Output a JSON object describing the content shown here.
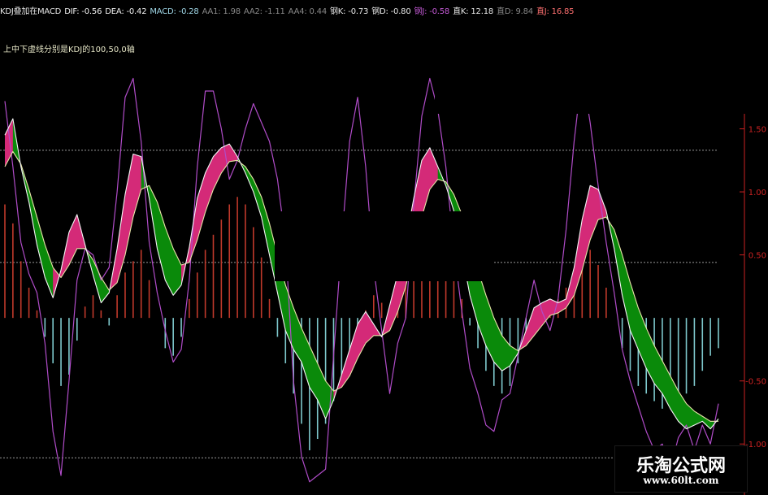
{
  "legend": [
    {
      "text": "KDJ叠加在MACD",
      "color": "#e6e6e6"
    },
    {
      "text": "DIF: -0.56",
      "color": "#f2f2f2"
    },
    {
      "text": "DEA: -0.42",
      "color": "#f2f2f2"
    },
    {
      "text": "MACD: -0.28",
      "color": "#9fd6e6"
    },
    {
      "text": "AA1: 1.98",
      "color": "#888888"
    },
    {
      "text": "AA2: -1.11",
      "color": "#888888"
    },
    {
      "text": "AA4: 0.44",
      "color": "#888888"
    },
    {
      "text": "钢K: -0.73",
      "color": "#e6e6e6"
    },
    {
      "text": "钢D: -0.80",
      "color": "#e6e6e6"
    },
    {
      "text": "钢J: -0.58",
      "color": "#c45ad6"
    },
    {
      "text": "直K: 12.18",
      "color": "#e6e6e6"
    },
    {
      "text": "直D: 9.84",
      "color": "#888888"
    },
    {
      "text": "直J: 16.85",
      "color": "#ff7070"
    }
  ],
  "note": "上中下虚线分别是KDJ的100,50,0轴",
  "watermark": {
    "title": "乐淘公式网",
    "url": "www.60lt.com"
  },
  "colors": {
    "background": "#000000",
    "dif": "#f5f5f5",
    "dea": "#e8e4a8",
    "kdj_j": "#b04cc8",
    "band_up": "#d42a78",
    "band_down": "#0a8a0a",
    "hist_pos": "#c0392b",
    "hist_neg": "#7ec8cc",
    "grid": "#9a9a9a",
    "axis": "#cc2222"
  },
  "chart_data": {
    "type": "line",
    "title": "",
    "xlabel": "",
    "ylabel": "",
    "ylim": [
      -1.25,
      1.6
    ],
    "yticks": [
      "1.50",
      "1.00",
      "0.50",
      "-0.50",
      "-1.00"
    ],
    "yticks_values": [
      1.5,
      1.0,
      0.5,
      -0.5,
      -1.0
    ],
    "reference_lines": [
      {
        "label": "KDJ 100",
        "value": 1.33
      },
      {
        "label": "KDJ 50",
        "value": 0.44
      },
      {
        "label": "KDJ 0",
        "value": -1.11
      }
    ],
    "x": [
      0,
      1,
      2,
      3,
      4,
      5,
      6,
      7,
      8,
      9,
      10,
      11,
      12,
      13,
      14,
      15,
      16,
      17,
      18,
      19,
      20,
      21,
      22,
      23,
      24,
      25,
      26,
      27,
      28,
      29,
      30,
      31,
      32,
      33,
      34,
      35,
      36,
      37,
      38,
      39,
      40,
      41,
      42,
      43,
      44,
      45,
      46,
      47,
      48,
      49,
      50,
      51,
      52,
      53,
      54,
      55,
      56,
      57,
      58,
      59,
      60,
      61,
      62,
      63,
      64,
      65,
      66,
      67,
      68,
      69,
      70,
      71,
      72,
      73,
      74,
      75,
      76,
      77,
      78,
      79,
      80,
      81,
      82,
      83,
      84,
      85,
      86,
      87,
      88,
      89
    ],
    "series": [
      {
        "name": "DIF",
        "values": [
          1.45,
          1.58,
          1.2,
          0.92,
          0.58,
          0.32,
          0.16,
          0.38,
          0.68,
          0.82,
          0.58,
          0.34,
          0.12,
          0.2,
          0.55,
          0.98,
          1.3,
          1.28,
          0.95,
          0.55,
          0.3,
          0.18,
          0.26,
          0.56,
          0.95,
          1.15,
          1.28,
          1.35,
          1.38,
          1.28,
          1.15,
          1.0,
          0.8,
          0.5,
          0.2,
          -0.1,
          -0.25,
          -0.35,
          -0.55,
          -0.65,
          -0.8,
          -0.65,
          -0.45,
          -0.25,
          -0.05,
          0.05,
          -0.05,
          -0.15,
          0.1,
          0.35,
          0.6,
          0.95,
          1.25,
          1.35,
          1.2,
          1.05,
          0.85,
          0.52,
          0.18,
          -0.05,
          -0.22,
          -0.35,
          -0.42,
          -0.38,
          -0.28,
          -0.1,
          0.08,
          0.12,
          0.15,
          0.12,
          0.15,
          0.4,
          0.78,
          1.05,
          1.02,
          0.85,
          0.55,
          0.18,
          -0.1,
          -0.25,
          -0.4,
          -0.52,
          -0.6,
          -0.72,
          -0.82,
          -0.88,
          -0.85,
          -0.82,
          -0.88,
          -0.8
        ]
      },
      {
        "name": "DEA",
        "values": [
          1.2,
          1.32,
          1.22,
          1.02,
          0.8,
          0.58,
          0.4,
          0.32,
          0.42,
          0.55,
          0.55,
          0.46,
          0.32,
          0.22,
          0.28,
          0.5,
          0.8,
          1.02,
          1.05,
          0.92,
          0.72,
          0.55,
          0.42,
          0.44,
          0.62,
          0.84,
          1.02,
          1.15,
          1.24,
          1.25,
          1.2,
          1.1,
          0.96,
          0.75,
          0.5,
          0.26,
          0.08,
          -0.08,
          -0.22,
          -0.36,
          -0.5,
          -0.58,
          -0.55,
          -0.46,
          -0.32,
          -0.2,
          -0.14,
          -0.14,
          -0.1,
          0.05,
          0.25,
          0.52,
          0.8,
          1.02,
          1.1,
          1.08,
          0.98,
          0.82,
          0.6,
          0.38,
          0.18,
          0.0,
          -0.14,
          -0.22,
          -0.26,
          -0.22,
          -0.14,
          -0.06,
          0.02,
          0.04,
          0.08,
          0.18,
          0.38,
          0.62,
          0.78,
          0.8,
          0.7,
          0.5,
          0.28,
          0.08,
          -0.08,
          -0.22,
          -0.34,
          -0.46,
          -0.58,
          -0.68,
          -0.74,
          -0.78,
          -0.82,
          -0.82
        ]
      },
      {
        "name": "KDJ-J",
        "values": [
          1.72,
          1.2,
          0.6,
          0.35,
          0.2,
          -0.2,
          -0.9,
          -1.25,
          -0.5,
          0.3,
          0.55,
          0.5,
          0.3,
          0.4,
          1.0,
          1.75,
          1.9,
          1.4,
          0.6,
          0.2,
          -0.1,
          -0.35,
          -0.25,
          0.3,
          1.2,
          1.8,
          1.8,
          1.5,
          1.1,
          1.25,
          1.5,
          1.7,
          1.55,
          1.4,
          1.1,
          0.6,
          -0.5,
          -1.1,
          -1.3,
          -1.25,
          -1.2,
          -0.3,
          0.6,
          1.4,
          1.75,
          1.2,
          0.4,
          -0.1,
          -0.6,
          -0.2,
          0.0,
          0.9,
          1.6,
          1.9,
          1.65,
          1.2,
          0.55,
          0.05,
          -0.4,
          -0.6,
          -0.85,
          -0.9,
          -0.65,
          -0.6,
          -0.3,
          0.0,
          0.3,
          0.05,
          -0.1,
          0.15,
          0.7,
          1.4,
          1.95,
          1.55,
          1.05,
          0.6,
          0.2,
          -0.25,
          -0.5,
          -0.7,
          -0.9,
          -1.05,
          -1.0,
          -1.2,
          -0.95,
          -0.85,
          -1.05,
          -0.85,
          -1.0,
          -0.68
        ]
      },
      {
        "name": "MACD",
        "values": [
          0.3,
          0.25,
          0.15,
          0.08,
          0.02,
          -0.05,
          -0.12,
          -0.18,
          -0.15,
          -0.06,
          0.03,
          0.06,
          0.02,
          -0.02,
          0.06,
          0.12,
          0.15,
          0.18,
          0.1,
          0.0,
          -0.08,
          -0.1,
          -0.05,
          0.05,
          0.12,
          0.18,
          0.22,
          0.26,
          0.3,
          0.32,
          0.3,
          0.24,
          0.16,
          0.05,
          -0.05,
          -0.12,
          -0.2,
          -0.28,
          -0.35,
          -0.32,
          -0.28,
          -0.22,
          -0.16,
          -0.1,
          -0.04,
          0.02,
          0.06,
          0.04,
          0.02,
          0.05,
          0.1,
          0.16,
          0.2,
          0.22,
          0.22,
          0.18,
          0.12,
          0.05,
          -0.02,
          -0.08,
          -0.14,
          -0.18,
          -0.2,
          -0.18,
          -0.12,
          -0.06,
          0.0,
          0.02,
          0.04,
          0.05,
          0.08,
          0.12,
          0.16,
          0.18,
          0.14,
          0.08,
          0.0,
          -0.08,
          -0.14,
          -0.18,
          -0.2,
          -0.22,
          -0.24,
          -0.24,
          -0.22,
          -0.2,
          -0.18,
          -0.14,
          -0.1,
          -0.08
        ]
      }
    ]
  }
}
